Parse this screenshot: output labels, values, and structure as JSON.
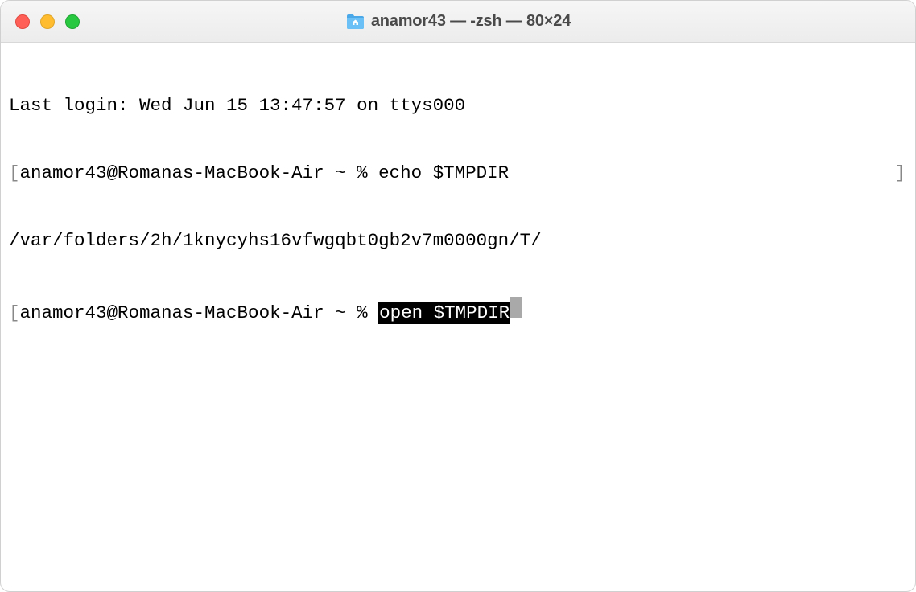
{
  "window": {
    "title": "anamor43 — -zsh — 80×24"
  },
  "terminal": {
    "last_login": "Last login: Wed Jun 15 13:47:57 on ttys000",
    "bracket_left": "[",
    "bracket_right": "]",
    "prompt1_host": "anamor43@Romanas-MacBook-Air ~ % ",
    "prompt1_cmd": "echo $TMPDIR",
    "output1": "/var/folders/2h/1knycyhs16vfwgqbt0gb2v7m0000gn/T/",
    "prompt2_host": "anamor43@Romanas-MacBook-Air ~ % ",
    "prompt2_cmd": "open $TMPDIR"
  },
  "icons": {
    "folder": "home"
  }
}
